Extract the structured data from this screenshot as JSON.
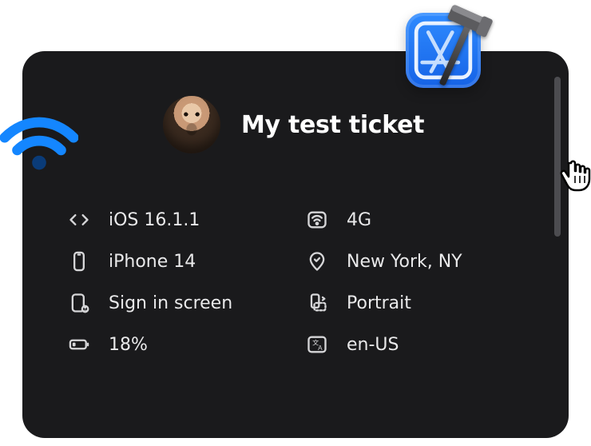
{
  "header": {
    "title": "My test ticket"
  },
  "details": {
    "os": "iOS 16.1.1",
    "network": "4G",
    "device": "iPhone 14",
    "location": "New York, NY",
    "screen": "Sign in screen",
    "orientation": "Portrait",
    "battery": "18%",
    "locale": "en-US"
  }
}
